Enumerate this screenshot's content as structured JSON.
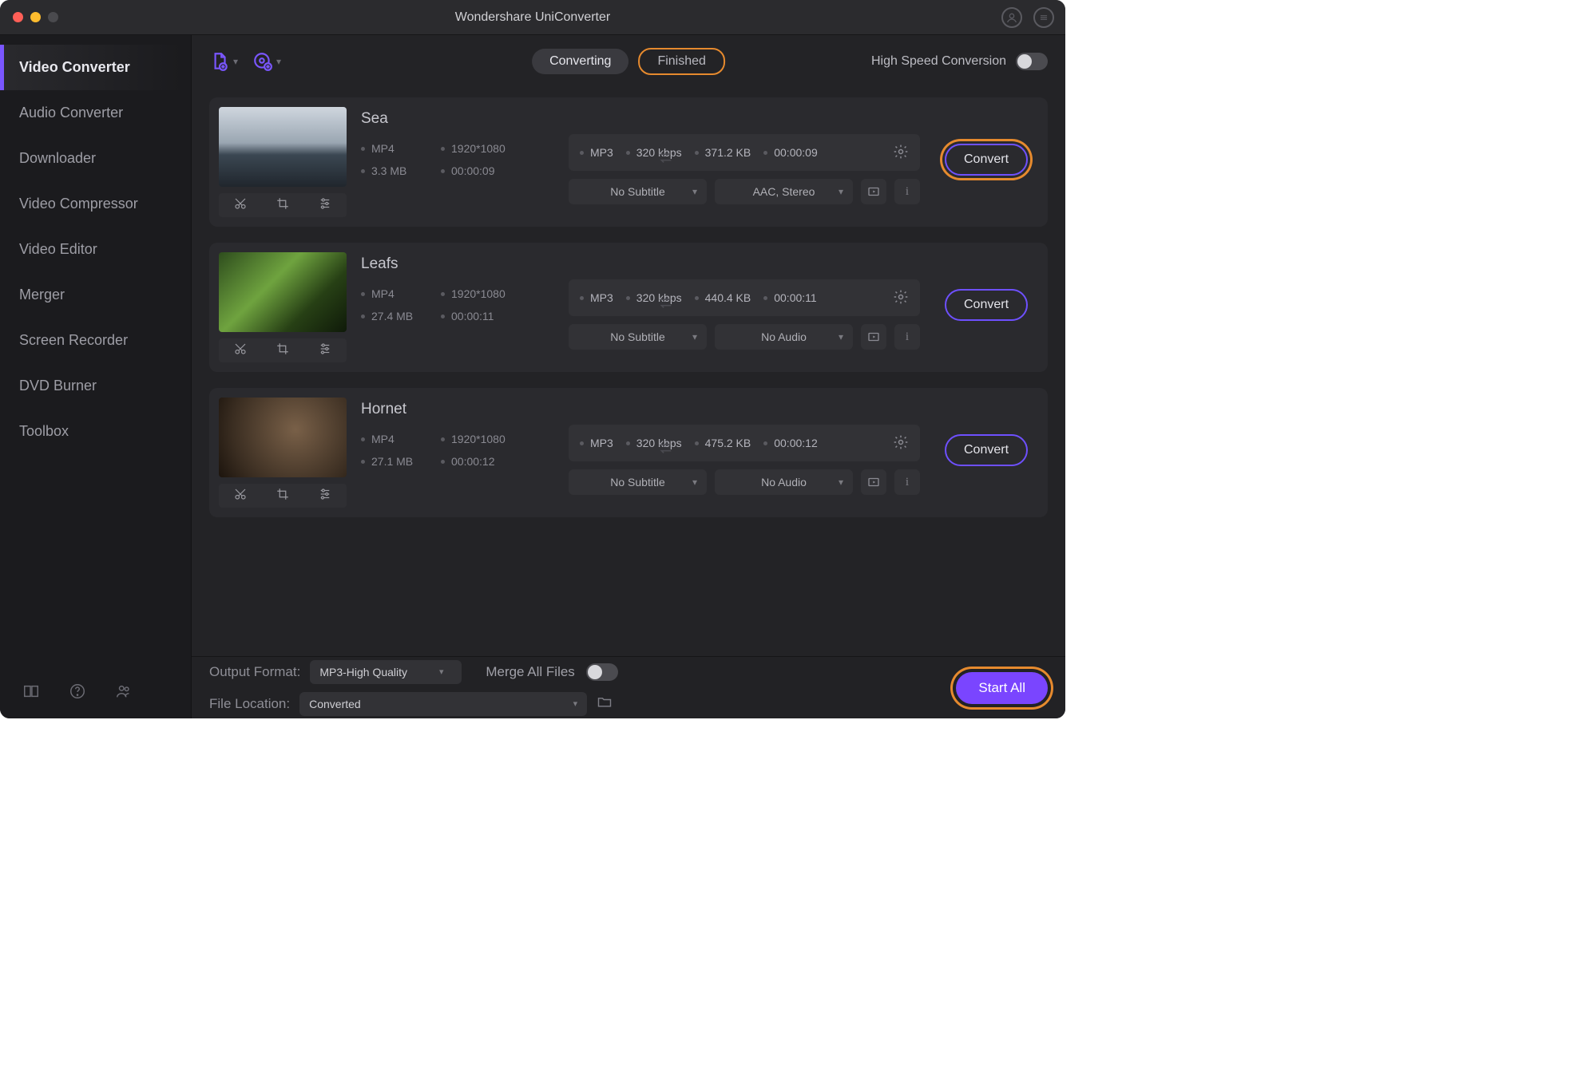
{
  "app": {
    "title": "Wondershare UniConverter"
  },
  "sidebar": {
    "items": [
      "Video Converter",
      "Audio Converter",
      "Downloader",
      "Video Compressor",
      "Video Editor",
      "Merger",
      "Screen Recorder",
      "DVD Burner",
      "Toolbox"
    ],
    "activeIndex": 0
  },
  "topbar": {
    "tab_converting": "Converting",
    "tab_finished": "Finished",
    "hsc_label": "High Speed Conversion"
  },
  "files": [
    {
      "name": "Sea",
      "src": {
        "fmt": "MP4",
        "res": "1920*1080",
        "size": "3.3 MB",
        "dur": "00:00:09"
      },
      "tgt": {
        "fmt": "MP3",
        "bitrate": "320 kbps",
        "size": "371.2 KB",
        "dur": "00:00:09"
      },
      "subtitle": "No Subtitle",
      "audio": "AAC, Stereo",
      "thumbClass": "sea",
      "highlight": true
    },
    {
      "name": "Leafs",
      "src": {
        "fmt": "MP4",
        "res": "1920*1080",
        "size": "27.4 MB",
        "dur": "00:00:11"
      },
      "tgt": {
        "fmt": "MP3",
        "bitrate": "320 kbps",
        "size": "440.4 KB",
        "dur": "00:00:11"
      },
      "subtitle": "No Subtitle",
      "audio": "No Audio",
      "thumbClass": "leafs",
      "highlight": false
    },
    {
      "name": "Hornet",
      "src": {
        "fmt": "MP4",
        "res": "1920*1080",
        "size": "27.1 MB",
        "dur": "00:00:12"
      },
      "tgt": {
        "fmt": "MP3",
        "bitrate": "320 kbps",
        "size": "475.2 KB",
        "dur": "00:00:12"
      },
      "subtitle": "No Subtitle",
      "audio": "No Audio",
      "thumbClass": "hornet",
      "highlight": false
    }
  ],
  "buttons": {
    "convert": "Convert",
    "startall": "Start All"
  },
  "footer": {
    "output_label": "Output Format:",
    "output_value": "MP3-High Quality",
    "location_label": "File Location:",
    "location_value": "Converted",
    "merge_label": "Merge All Files"
  }
}
